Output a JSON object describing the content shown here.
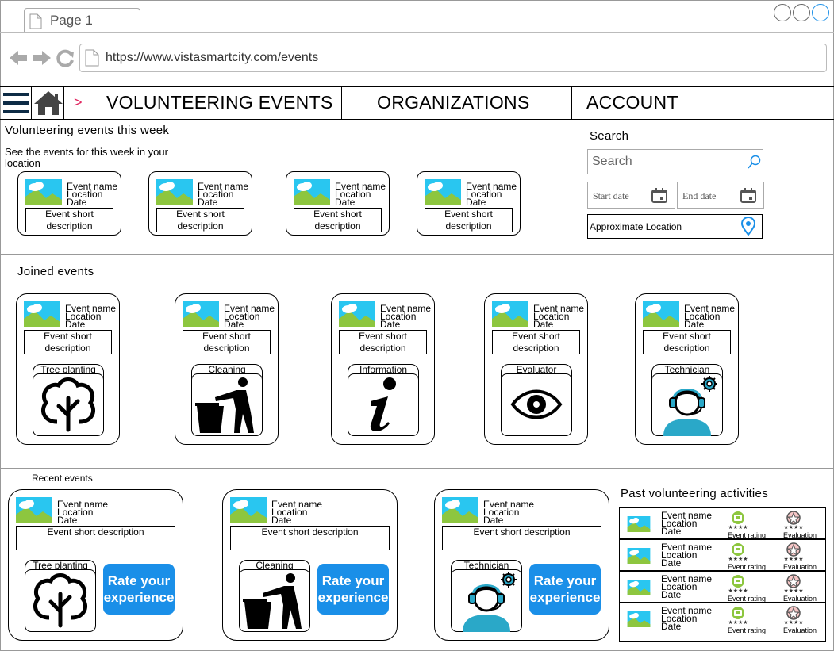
{
  "browser": {
    "tab_title": "Page 1",
    "url": "https://www.vistasmartcity.com/events"
  },
  "nav": {
    "items": [
      "VOLUNTEERING EVENTS",
      "ORGANIZATIONS",
      "ACCOUNT"
    ],
    "chevron": ">"
  },
  "week": {
    "title": "Volunteering events this week",
    "subtitle": "See the events for this week in your location",
    "cards": [
      {
        "name": "Event name",
        "location": "Location",
        "date": "Date",
        "desc": "Event short description"
      },
      {
        "name": "Event name",
        "location": "Location",
        "date": "Date",
        "desc": "Event short description"
      },
      {
        "name": "Event name",
        "location": "Location",
        "date": "Date",
        "desc": "Event short description"
      },
      {
        "name": "Event name",
        "location": "Location",
        "date": "Date",
        "desc": "Event short description"
      }
    ]
  },
  "search": {
    "title": "Search",
    "placeholder": "Search",
    "start_date": "Start date",
    "end_date": "End date",
    "location": "Approximate Location"
  },
  "joined": {
    "title": "Joined events",
    "cards": [
      {
        "name": "Event name",
        "location": "Location",
        "date": "Date",
        "desc": "Event short description",
        "role": "Tree planting",
        "icon": "tree-icon"
      },
      {
        "name": "Event name",
        "location": "Location",
        "date": "Date",
        "desc": "Event short description",
        "role": "Cleaning",
        "icon": "trash-person-icon"
      },
      {
        "name": "Event name",
        "location": "Location",
        "date": "Date",
        "desc": "Event short description",
        "role": "Information",
        "icon": "info-icon"
      },
      {
        "name": "Event name",
        "location": "Location",
        "date": "Date",
        "desc": "Event short description",
        "role": "Evaluator",
        "icon": "eye-icon"
      },
      {
        "name": "Event name",
        "location": "Location",
        "date": "Date",
        "desc": "Event short description",
        "role": "Technician",
        "icon": "technician-icon"
      }
    ]
  },
  "recent": {
    "title": "Recent events",
    "rate_label": "Rate your experience",
    "cards": [
      {
        "name": "Event name",
        "location": "Location",
        "date": "Date",
        "desc": "Event short description",
        "role": "Tree planting",
        "icon": "tree-icon"
      },
      {
        "name": "Event name",
        "location": "Location",
        "date": "Date",
        "desc": "Event short description",
        "role": "Cleaning",
        "icon": "trash-person-icon"
      },
      {
        "name": "Event name",
        "location": "Location",
        "date": "Date",
        "desc": "Event short description",
        "role": "Technician",
        "icon": "technician-icon"
      }
    ]
  },
  "past": {
    "title": "Past volunteering activities",
    "rating_label": "Event rating",
    "evaluation_label": "Evaluation",
    "rows": [
      {
        "name": "Event name",
        "location": "Location",
        "date": "Date"
      },
      {
        "name": "Event name",
        "location": "Location",
        "date": "Date"
      },
      {
        "name": "Event name",
        "location": "Location",
        "date": "Date"
      },
      {
        "name": "Event name",
        "location": "Location",
        "date": "Date"
      }
    ]
  },
  "colors": {
    "accent": "#1a8fe8",
    "chevron": "#e0245e",
    "nav_icon": "#0d2b45"
  }
}
